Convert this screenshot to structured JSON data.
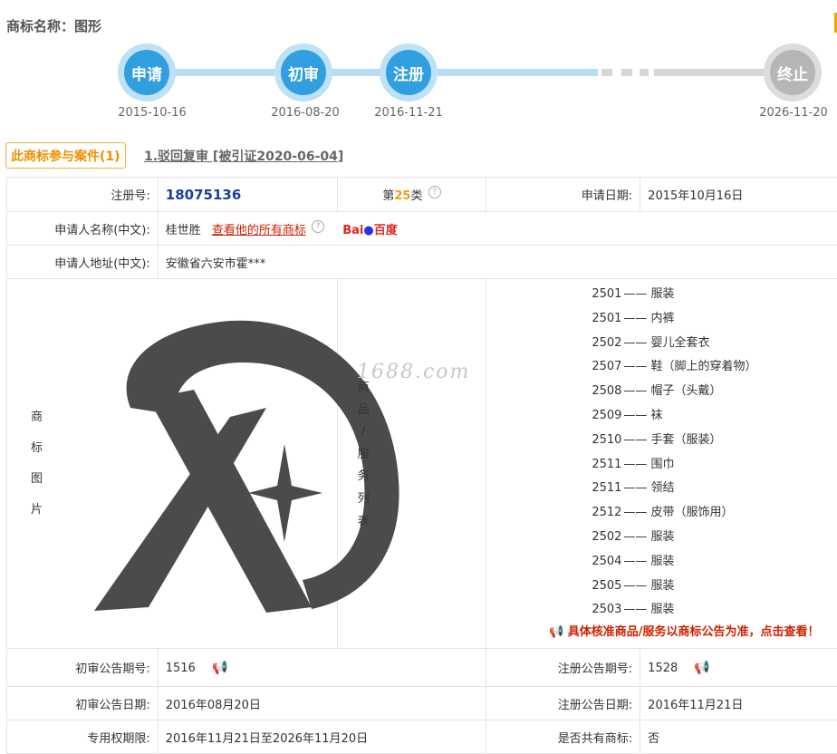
{
  "header": {
    "title": "商标名称：图形"
  },
  "timeline": {
    "steps": [
      {
        "label": "申请",
        "date": "2015-10-16"
      },
      {
        "label": "初审",
        "date": "2016-08-20"
      },
      {
        "label": "注册",
        "date": "2016-11-21"
      },
      {
        "label": "终止",
        "date": "2026-11-20"
      }
    ]
  },
  "cases": {
    "tab_label": "此商标参与案件(1)",
    "case_link": "1.驳回复审 [被引证2020-06-04]"
  },
  "info": {
    "reg_no_label": "注册号:",
    "reg_no": "18075136",
    "class_prefix": "第",
    "class_num": "25",
    "class_suffix": "类",
    "apply_date_label": "申请日期:",
    "apply_date": "2015年10月16日",
    "applicant_label": "申请人名称(中文):",
    "applicant": "桂世胜",
    "view_all": "查看他的所有商标",
    "baidu_a": "Bai",
    "baidu_b": "百度",
    "address_label": "申请人地址(中文):",
    "address": "安徽省六安市霍***",
    "image_label": [
      "商",
      "标",
      "图",
      "片"
    ],
    "goods_label": [
      "商",
      "品",
      "/",
      "服",
      "务",
      "列",
      "表"
    ],
    "goods": [
      {
        "code": "2501",
        "name": "服装"
      },
      {
        "code": "2501",
        "name": "内裤"
      },
      {
        "code": "2502",
        "name": "婴儿全套衣"
      },
      {
        "code": "2507",
        "name": "鞋（脚上的穿着物）"
      },
      {
        "code": "2508",
        "name": "帽子（头戴）"
      },
      {
        "code": "2509",
        "name": "袜"
      },
      {
        "code": "2510",
        "name": "手套（服装）"
      },
      {
        "code": "2511",
        "name": "围巾"
      },
      {
        "code": "2511",
        "name": "领结"
      },
      {
        "code": "2512",
        "name": "皮带（服饰用）"
      },
      {
        "code": "2502",
        "name": "服装"
      },
      {
        "code": "2504",
        "name": "服装"
      },
      {
        "code": "2505",
        "name": "服装"
      },
      {
        "code": "2503",
        "name": "服装"
      }
    ],
    "goods_notice": "具体核准商品/服务以商标公告为准，点击查看！",
    "watermark": "1688.com",
    "prelim_no_label": "初审公告期号:",
    "prelim_no": "1516",
    "reg_pub_no_label": "注册公告期号:",
    "reg_pub_no": "1528",
    "prelim_date_label": "初审公告日期:",
    "prelim_date": "2016年08月20日",
    "reg_pub_date_label": "注册公告日期:",
    "reg_pub_date": "2016年11月21日",
    "rights_label": "专用权期限:",
    "rights": "2016年11月21日至2026年11月20日",
    "shared_label": "是否共有商标:",
    "shared": "否"
  }
}
